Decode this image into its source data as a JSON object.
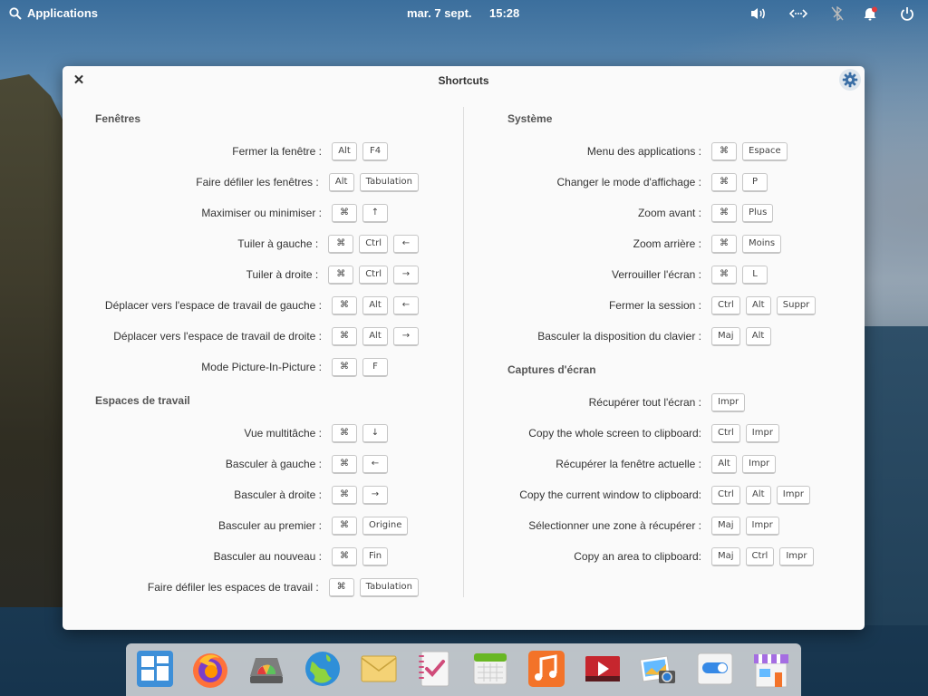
{
  "panel": {
    "applications_label": "Applications",
    "date": "mar. 7 sept.",
    "time": "15:28",
    "indicators": [
      "volume-icon",
      "network-icon",
      "bluetooth-icon",
      "notifications-icon",
      "power-icon"
    ]
  },
  "window": {
    "title": "Shortcuts"
  },
  "sections": {
    "windows": {
      "heading": "Fenêtres",
      "rows": [
        {
          "label": "Fermer la fenêtre :",
          "keys": [
            "Alt",
            "F4"
          ]
        },
        {
          "label": "Faire défiler les fenêtres :",
          "keys": [
            "Alt",
            "Tabulation"
          ]
        },
        {
          "label": "Maximiser ou minimiser :",
          "keys": [
            "⌘",
            "↑"
          ]
        },
        {
          "label": "Tuiler à gauche :",
          "keys": [
            "⌘",
            "Ctrl",
            "←"
          ]
        },
        {
          "label": "Tuiler à droite :",
          "keys": [
            "⌘",
            "Ctrl",
            "→"
          ]
        },
        {
          "label": "Déplacer vers l'espace de travail de gauche :",
          "keys": [
            "⌘",
            "Alt",
            "←"
          ]
        },
        {
          "label": "Déplacer vers l'espace de travail de droite :",
          "keys": [
            "⌘",
            "Alt",
            "→"
          ]
        },
        {
          "label": "Mode Picture-In-Picture :",
          "keys": [
            "⌘",
            "F"
          ]
        }
      ]
    },
    "workspaces": {
      "heading": "Espaces de travail",
      "rows": [
        {
          "label": "Vue multitâche :",
          "keys": [
            "⌘",
            "↓"
          ]
        },
        {
          "label": "Basculer à gauche :",
          "keys": [
            "⌘",
            "←"
          ]
        },
        {
          "label": "Basculer à droite :",
          "keys": [
            "⌘",
            "→"
          ]
        },
        {
          "label": "Basculer au premier :",
          "keys": [
            "⌘",
            "Origine"
          ]
        },
        {
          "label": "Basculer au nouveau :",
          "keys": [
            "⌘",
            "Fin"
          ]
        },
        {
          "label": "Faire défiler les espaces de travail :",
          "keys": [
            "⌘",
            "Tabulation"
          ]
        }
      ]
    },
    "system": {
      "heading": "Système",
      "rows": [
        {
          "label": "Menu des applications :",
          "keys": [
            "⌘",
            "Espace"
          ]
        },
        {
          "label": "Changer le mode d'affichage :",
          "keys": [
            "⌘",
            "P"
          ]
        },
        {
          "label": "Zoom avant :",
          "keys": [
            "⌘",
            "Plus"
          ]
        },
        {
          "label": "Zoom arrière :",
          "keys": [
            "⌘",
            "Moins"
          ]
        },
        {
          "label": "Verrouiller l'écran :",
          "keys": [
            "⌘",
            "L"
          ]
        },
        {
          "label": "Fermer la session :",
          "keys": [
            "Ctrl",
            "Alt",
            "Suppr"
          ]
        },
        {
          "label": "Basculer la disposition du clavier :",
          "keys": [
            "Maj",
            "Alt"
          ]
        }
      ]
    },
    "screenshots": {
      "heading": "Captures d'écran",
      "rows": [
        {
          "label": "Récupérer tout l'écran :",
          "keys": [
            "Impr"
          ]
        },
        {
          "label": "Copy the whole screen to clipboard:",
          "keys": [
            "Ctrl",
            "Impr"
          ]
        },
        {
          "label": "Récupérer la fenêtre actuelle :",
          "keys": [
            "Alt",
            "Impr"
          ]
        },
        {
          "label": "Copy the current window to clipboard:",
          "keys": [
            "Ctrl",
            "Alt",
            "Impr"
          ]
        },
        {
          "label": "Sélectionner une zone à récupérer :",
          "keys": [
            "Maj",
            "Impr"
          ]
        },
        {
          "label": "Copy an area to clipboard:",
          "keys": [
            "Maj",
            "Ctrl",
            "Impr"
          ]
        }
      ]
    }
  },
  "dock": {
    "items": [
      "multitasking-view-icon",
      "firefox-icon",
      "disk-usage-icon",
      "web-browser-icon",
      "mail-icon",
      "tasks-icon",
      "calendar-icon",
      "music-icon",
      "videos-icon",
      "photos-icon",
      "system-settings-icon",
      "appcenter-icon"
    ]
  }
}
